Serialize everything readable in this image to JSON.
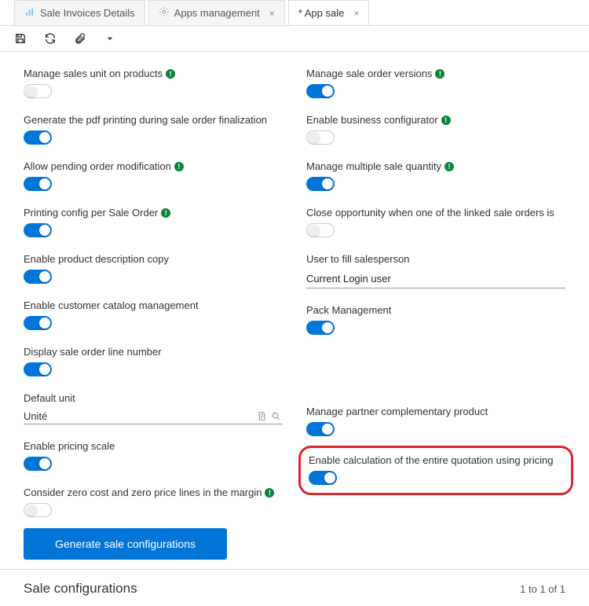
{
  "tabs": {
    "t0": {
      "label": "Sale Invoices Details"
    },
    "t1": {
      "label": "Apps management"
    },
    "t2": {
      "label": "* App sale"
    }
  },
  "left": {
    "manageSalesUnit": "Manage sales unit on products",
    "genPdf": "Generate the pdf printing during sale order finalization",
    "allowPending": "Allow pending order modification",
    "printingConfig": "Printing config per Sale Order",
    "enableProdDesc": "Enable product description copy",
    "enableCustCatalog": "Enable customer catalog management",
    "displayLineNum": "Display sale order line number",
    "defaultUnitLabel": "Default unit",
    "defaultUnitValue": "Unité",
    "enablePricing": "Enable pricing scale",
    "considerZero": "Consider zero cost and zero price lines in the margin"
  },
  "right": {
    "manageVersions": "Manage sale order versions",
    "enableBusiness": "Enable business configurator",
    "manageMulti": "Manage multiple sale quantity",
    "closeOpp": "Close opportunity when one of the linked sale orders is",
    "userFillLabel": "User to fill salesperson",
    "userFillValue": "Current Login user",
    "packMgmt": "Pack Management",
    "managePartner": "Manage partner complementary product",
    "enableCalc": "Enable calculation of the entire quotation using pricing"
  },
  "buttons": {
    "generate": "Generate sale configurations"
  },
  "section": {
    "title": "Sale configurations",
    "pager": "1 to 1 of 1"
  }
}
